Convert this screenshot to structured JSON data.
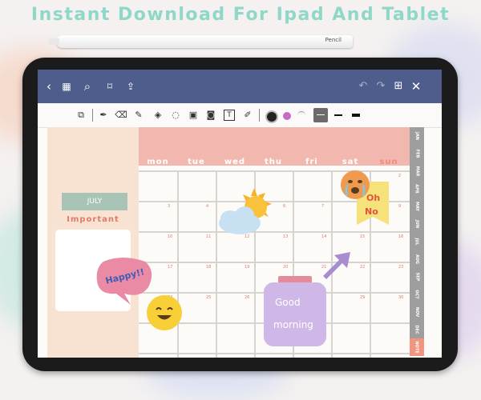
{
  "headline": "Instant Download For Ipad And Tablet",
  "pencil_label": "Pencil",
  "icons": {
    "back": "back-icon",
    "grid": "grid-icon",
    "search": "search-icon",
    "bookmark": "bookmark-icon",
    "share": "share-icon",
    "undo": "undo-icon",
    "redo": "redo-icon",
    "add_page": "add-page-icon",
    "close": "close-icon"
  },
  "toolbar": {
    "tools": [
      "document-icon",
      "pen-icon",
      "eraser-icon",
      "pencil-icon",
      "shapes-icon",
      "lasso-icon",
      "image-icon",
      "camera-icon",
      "text-icon",
      "highlighter-icon"
    ],
    "colors": [
      "#222222",
      "#c86bc6",
      "#ffffff"
    ],
    "selected_stroke": "thin"
  },
  "sidebar": {
    "month": "JULY",
    "section_title": "Important"
  },
  "calendar": {
    "days": [
      "mon",
      "tue",
      "wed",
      "thu",
      "fri",
      "sat",
      "sun"
    ],
    "rows": [
      [
        "",
        "",
        "",
        "",
        "",
        "1",
        "2"
      ],
      [
        "3",
        "4",
        "5",
        "6",
        "7",
        "8",
        "9"
      ],
      [
        "10",
        "11",
        "12",
        "13",
        "14",
        "15",
        "16"
      ],
      [
        "17",
        "18",
        "19",
        "20",
        "21",
        "22",
        "23"
      ],
      [
        "24",
        "25",
        "26",
        "27",
        "28",
        "29",
        "30"
      ],
      [
        "31",
        "",
        "",
        "",
        "",
        "",
        ""
      ]
    ]
  },
  "month_tabs": [
    "JAN",
    "FEB",
    "MAR",
    "APR",
    "MAY",
    "JUN",
    "JUL",
    "AUG",
    "SEP",
    "OCT",
    "NOV",
    "DEC",
    "NOTE"
  ],
  "active_tab": "NOTE",
  "stickers": {
    "happy": "Happy!!",
    "oh": "Oh",
    "no": "No",
    "good": "Good",
    "morning": "morning"
  },
  "colors": {
    "navbar": "#4f5d8d",
    "header": "#f2b8b0",
    "sidebar": "#f8e2d2",
    "month_box": "#a7c4b6",
    "accent_text": "#e07a6c",
    "headline": "#8fd8c8"
  }
}
